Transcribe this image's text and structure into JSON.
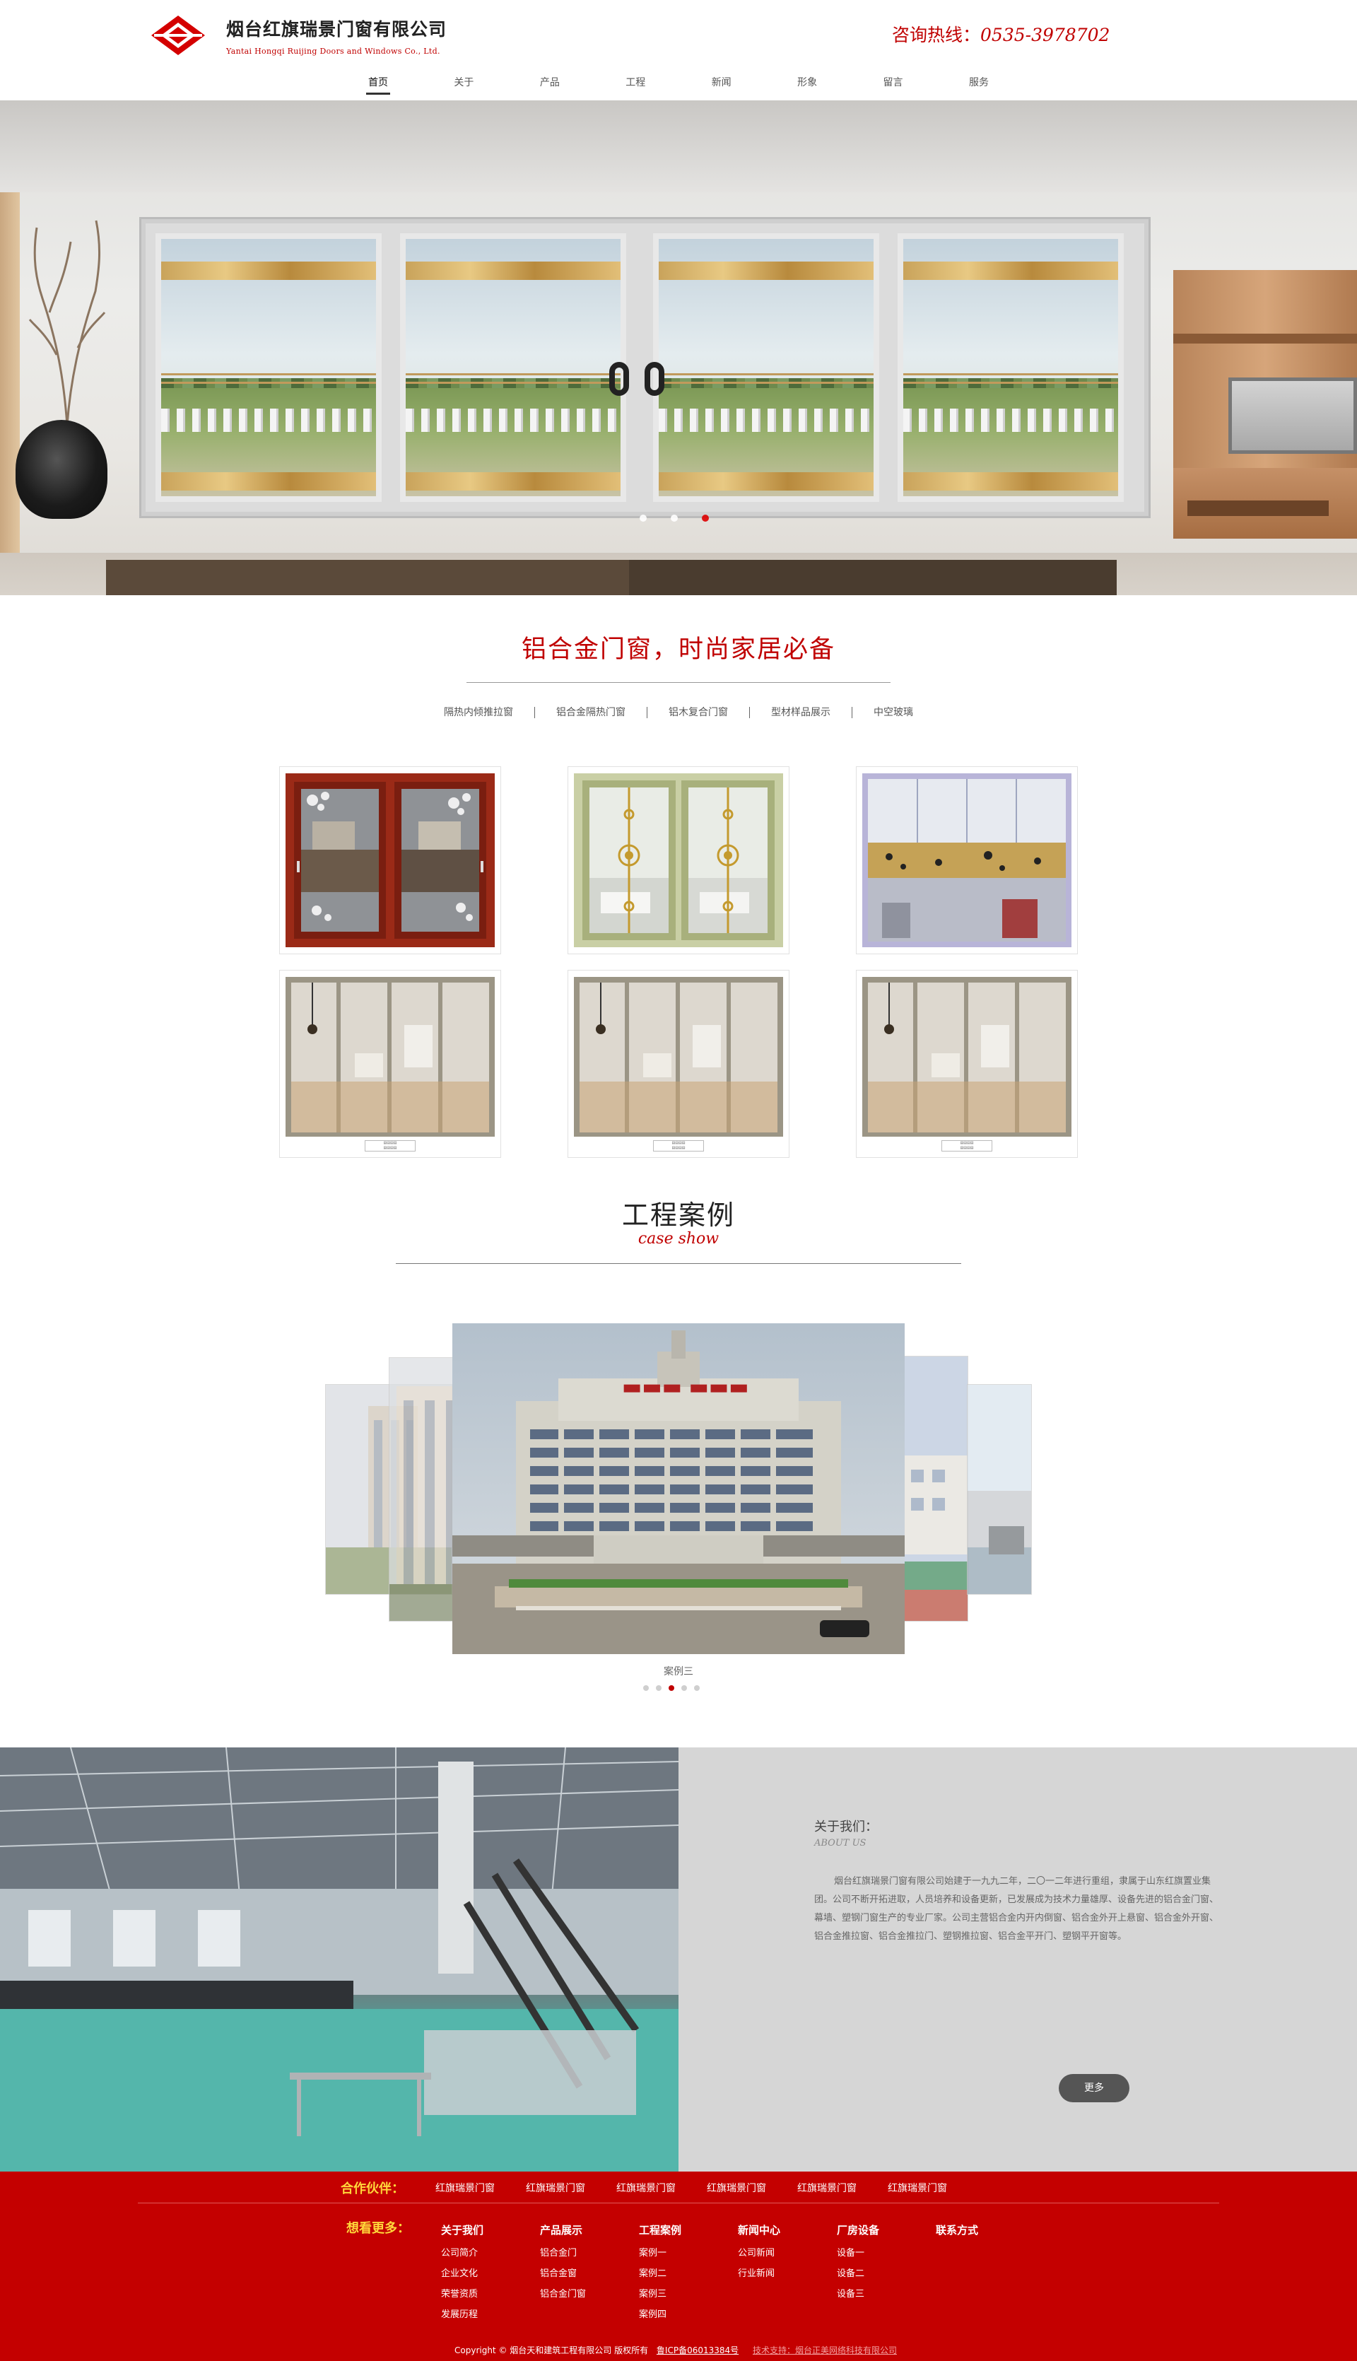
{
  "brand": {
    "name_cn": "烟台红旗瑞景门窗有限公司",
    "name_en": "Yantai Hongqi Ruijing Doors and Windows Co., Ltd.",
    "accent": "#c00000"
  },
  "hotline": {
    "label": "咨询热线：",
    "number": "0535-3978702"
  },
  "nav": [
    "首页",
    "关于",
    "产品",
    "工程",
    "新闻",
    "形象",
    "留言",
    "服务"
  ],
  "banner": {
    "slide_count": 3,
    "active_slide": 3
  },
  "products": {
    "title": "铝合金门窗，时尚家居必备",
    "categories": [
      "隔热内倾推拉窗",
      "铝合金隔热门窗",
      "铝木复合门窗",
      "型材样品展示",
      "中空玻璃"
    ]
  },
  "cases": {
    "title": "工程案例",
    "subtitle": "case show",
    "active_caption": "案例三",
    "slide_count": 5,
    "active_slide": 3
  },
  "about": {
    "title": "关于我们：",
    "subtitle": "ABOUT US",
    "body": "烟台红旗瑞景门窗有限公司始建于一九九二年，二〇一二年进行重组，隶属于山东红旗置业集团。公司不断开拓进取，人员培养和设备更新，已发展成为技术力量雄厚、设备先进的铝合金门窗、幕墙、塑钢门窗生产的专业厂家。公司主营铝合金内开内倒窗、铝合金外开上悬窗、铝合金外开窗、铝合金推拉窗、铝合金推拉门、塑钢推拉窗、铝合金平开门、塑钢平开窗等。",
    "more": "更多"
  },
  "footer": {
    "partners_label": "合作伙伴：",
    "partners": [
      "红旗瑞景门窗",
      "红旗瑞景门窗",
      "红旗瑞景门窗",
      "红旗瑞景门窗",
      "红旗瑞景门窗",
      "红旗瑞景门窗"
    ],
    "more_label": "想看更多：",
    "columns": [
      {
        "heading": "关于我们",
        "items": [
          "公司简介",
          "企业文化",
          "荣誉资质",
          "发展历程"
        ]
      },
      {
        "heading": "产品展示",
        "items": [
          "铝合金门",
          "铝合金窗",
          "铝合金门窗"
        ]
      },
      {
        "heading": "工程案例",
        "items": [
          "案例一",
          "案例二",
          "案例三",
          "案例四"
        ]
      },
      {
        "heading": "新闻中心",
        "items": [
          "公司新闻",
          "行业新闻"
        ]
      },
      {
        "heading": "厂房设备",
        "items": [
          "设备一",
          "设备二",
          "设备三"
        ]
      },
      {
        "heading": "联系方式",
        "items": []
      }
    ],
    "copyright": "Copyright © 烟台天和建筑工程有限公司 版权所有",
    "icp": "鲁ICP备06013384号",
    "tech": "技术支持：烟台正美网络科技有限公司"
  }
}
